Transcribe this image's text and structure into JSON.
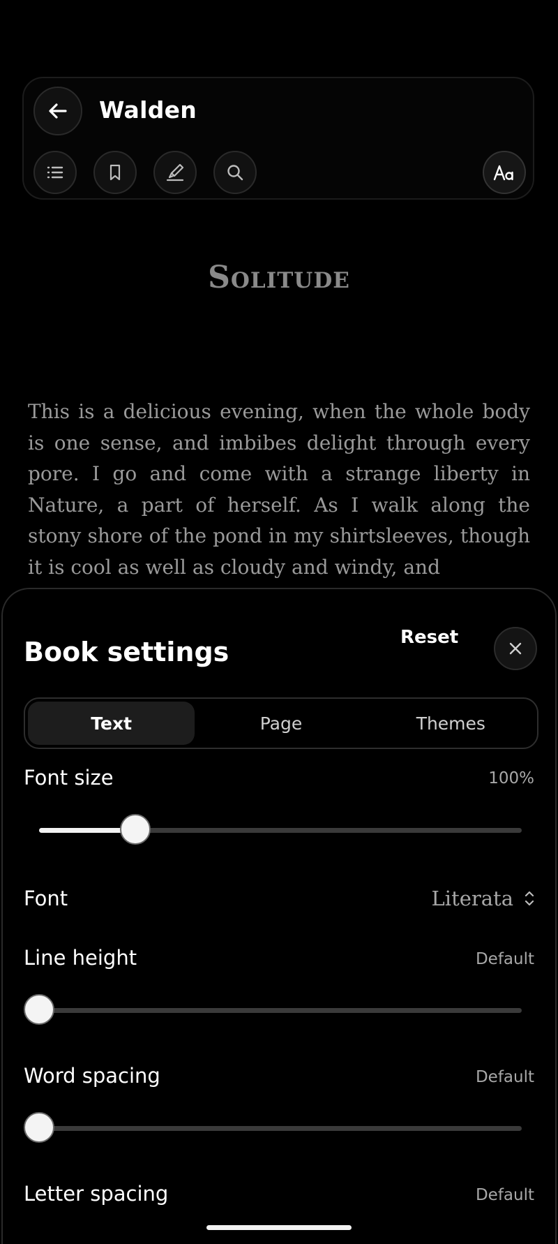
{
  "header": {
    "book_title": "Walden",
    "icons": {
      "back": "arrow-left-icon",
      "toc": "list-icon",
      "bookmark": "bookmark-icon",
      "highlight": "highlighter-icon",
      "search": "search-icon",
      "text_settings": "text-format-icon"
    }
  },
  "reader": {
    "chapter_title": "Solitude",
    "paragraph": "This is a delicious evening, when the whole body is one sense, and imbibes delight through every pore. I go and come with a strange liberty in Nature, a part of herself. As I walk along the stony shore of the pond in my shirtsleeves, though it is cool as well as cloudy and windy, and"
  },
  "settings": {
    "title": "Book settings",
    "reset_label": "Reset",
    "close_icon": "close-icon",
    "tabs": [
      {
        "label": "Text",
        "active": true
      },
      {
        "label": "Page",
        "active": false
      },
      {
        "label": "Themes",
        "active": false
      }
    ],
    "font_size": {
      "label": "Font size",
      "value_text": "100%",
      "slider_fraction": 0.2
    },
    "font": {
      "label": "Font",
      "value": "Literata"
    },
    "line_height": {
      "label": "Line height",
      "value_text": "Default",
      "slider_fraction": 0
    },
    "word_spacing": {
      "label": "Word spacing",
      "value_text": "Default",
      "slider_fraction": 0
    },
    "letter_spacing": {
      "label": "Letter spacing",
      "value_text": "Default"
    }
  },
  "colors": {
    "background": "#000000",
    "accent": "#ffffff",
    "muted_text": "#9a9a9a"
  }
}
